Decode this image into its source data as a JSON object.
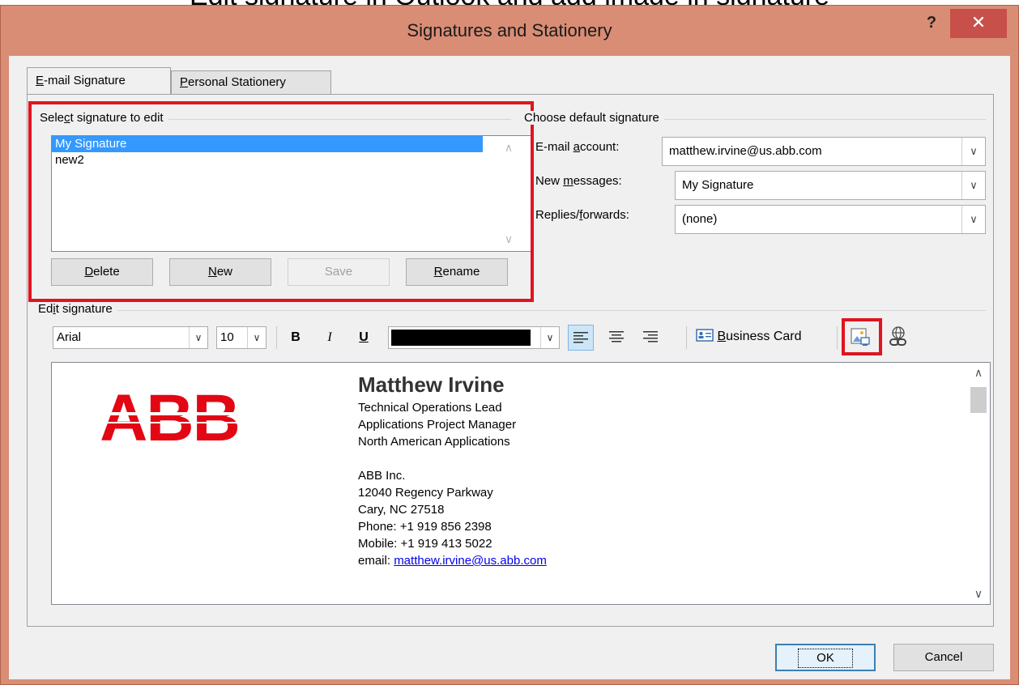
{
  "page_header": {
    "cut_text": "Edit signature in Outlook and add image in signature"
  },
  "dialog": {
    "title": "Signatures and Stationery",
    "help_label": "?",
    "close_label": "✕"
  },
  "tabs": [
    {
      "label": "E-mail Signature",
      "accel": "E",
      "rest": "-mail Signature",
      "active": true
    },
    {
      "label": "Personal Stationery",
      "accel": "P",
      "rest": "ersonal Stationery",
      "active": false
    }
  ],
  "select_signature": {
    "label_pre": "Sele",
    "label_accel": "c",
    "label_post": "t signature to edit",
    "items": [
      "My Signature",
      "new2"
    ],
    "selected_index": 0,
    "buttons": {
      "delete": {
        "accel": "D",
        "rest": "elete"
      },
      "new": {
        "accel": "N",
        "rest": "ew"
      },
      "save": {
        "label": "Save"
      },
      "rename": {
        "accel": "R",
        "rest": "ename"
      }
    }
  },
  "default_signature": {
    "label": "Choose default signature",
    "email_account": {
      "label_pre": "E-mail ",
      "label_accel": "a",
      "label_post": "ccount:",
      "value": "matthew.irvine@us.abb.com"
    },
    "new_messages": {
      "label_pre": "New ",
      "label_accel": "m",
      "label_post": "essages:",
      "value": "My Signature"
    },
    "replies_forwards": {
      "label_pre": "Replies/",
      "label_accel": "f",
      "label_post": "orwards:",
      "value": "(none)"
    }
  },
  "edit_signature": {
    "label_pre": "Ed",
    "label_accel": "i",
    "label_post": "t signature",
    "toolbar": {
      "font": "Arial",
      "size": "10",
      "bold": "B",
      "italic": "I",
      "underline": "U",
      "color_hex": "#000000",
      "business_card_accel": "B",
      "business_card_rest": "usiness Card"
    },
    "content": {
      "logo_text": "ABB",
      "logo_color": "#e30613",
      "name": "Matthew Irvine",
      "title_lines": [
        "Technical Operations Lead",
        "Applications Project Manager",
        "North American Applications"
      ],
      "address_lines": [
        "ABB Inc.",
        "12040 Regency Parkway",
        "Cary, NC 27518",
        "Phone: +1 919 856 2398",
        "Mobile: +1 919 413 5022"
      ],
      "email_label": "email: ",
      "email_link": "matthew.irvine@us.abb.com"
    }
  },
  "footer": {
    "ok": "OK",
    "cancel": "Cancel"
  },
  "highlight_color": "#e0141e",
  "window_color": "#d98d74"
}
